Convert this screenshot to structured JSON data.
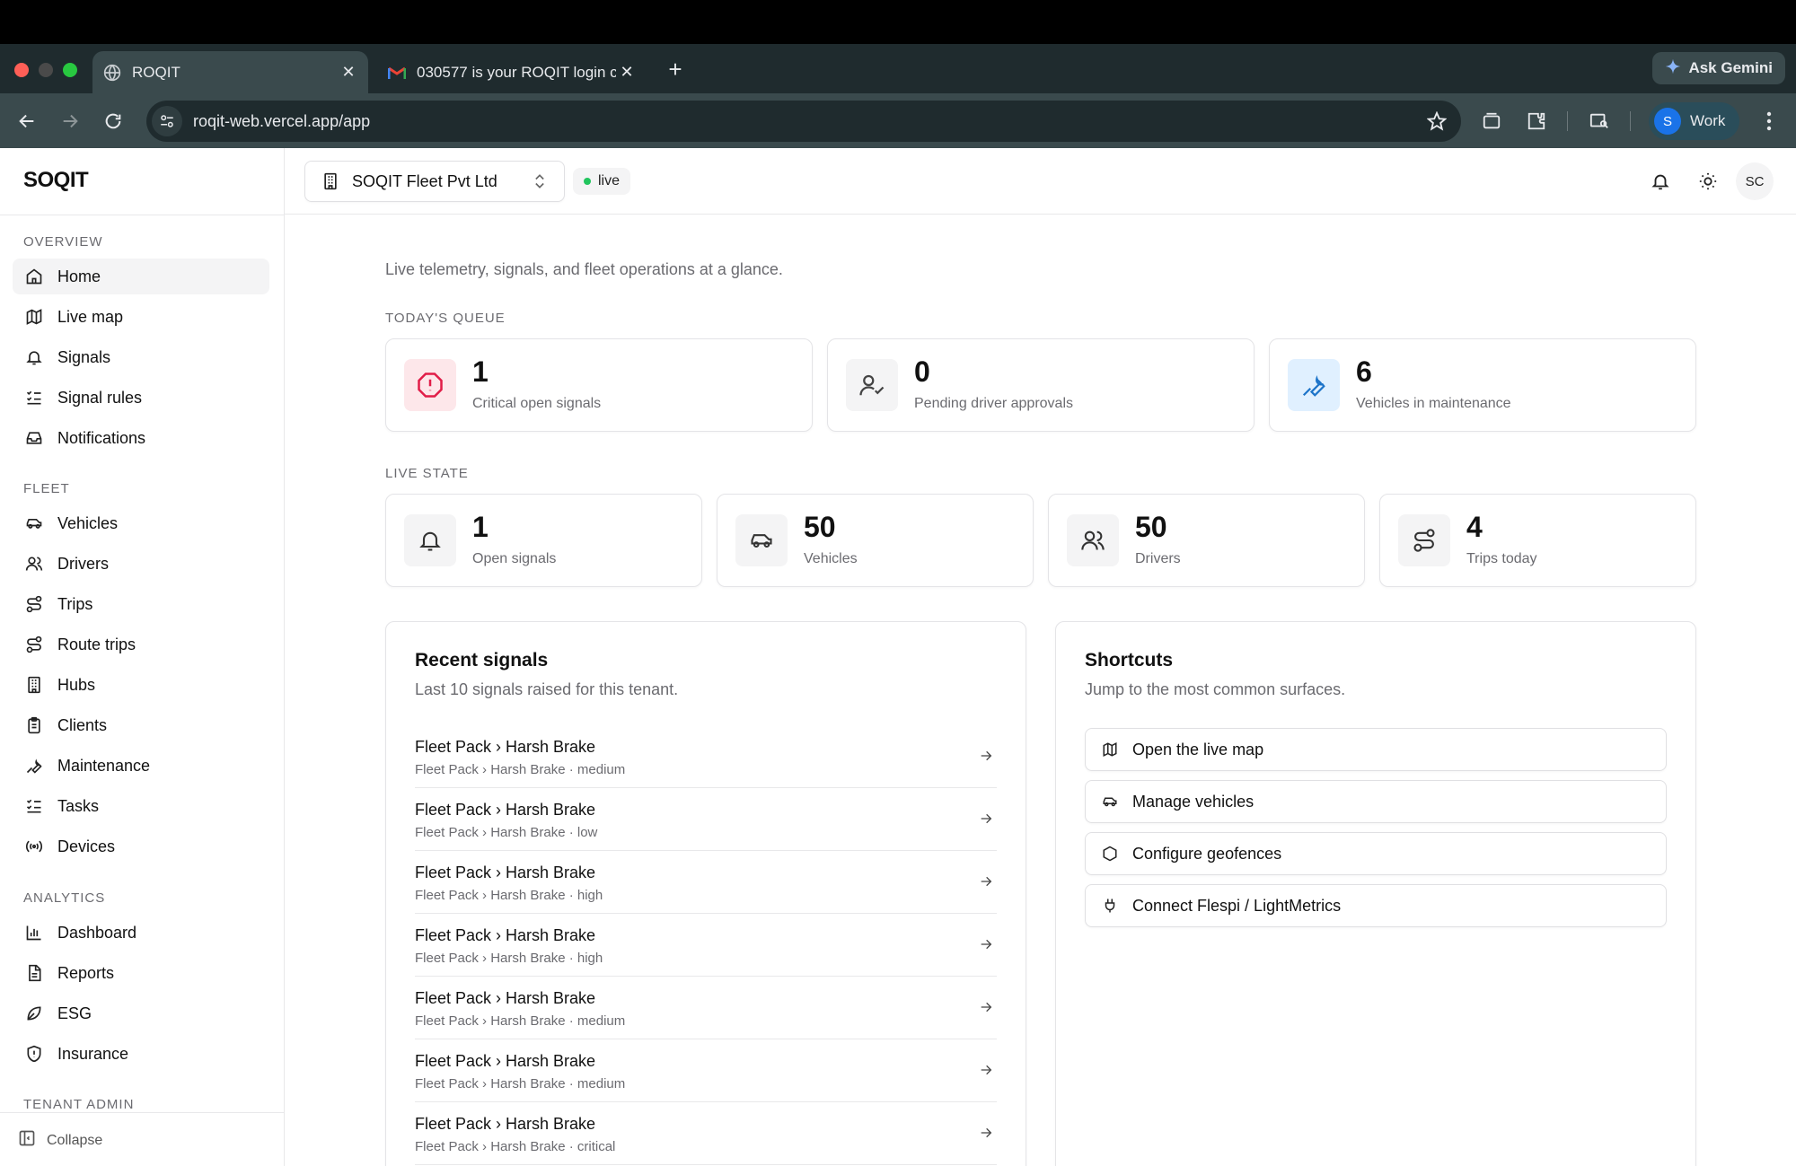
{
  "browser": {
    "tabs": [
      {
        "title": "ROQIT",
        "active": true
      },
      {
        "title": "030577 is your ROQIT login c",
        "active": false
      }
    ],
    "url": "roqit-web.vercel.app/app",
    "gemini_label": "Ask Gemini",
    "profile": {
      "initial": "S",
      "label": "Work"
    }
  },
  "app": {
    "brand": "SOQIT",
    "tenant": "SOQIT Fleet Pvt Ltd",
    "status_badge": "live",
    "user_initials": "SC",
    "colors": {
      "accent_green": "#22c55e",
      "critical_bg": "#fde7ea",
      "critical_fg": "#e11d48",
      "info_bg": "#e0f0ff",
      "info_fg": "#1d74c9"
    }
  },
  "sidebar": {
    "sections": [
      {
        "label": "OVERVIEW",
        "items": [
          {
            "label": "Home",
            "icon": "home-icon",
            "active": true
          },
          {
            "label": "Live map",
            "icon": "map-icon"
          },
          {
            "label": "Signals",
            "icon": "bell-icon"
          },
          {
            "label": "Signal rules",
            "icon": "list-checks-icon"
          },
          {
            "label": "Notifications",
            "icon": "inbox-icon"
          }
        ]
      },
      {
        "label": "FLEET",
        "items": [
          {
            "label": "Vehicles",
            "icon": "car-icon"
          },
          {
            "label": "Drivers",
            "icon": "users-icon"
          },
          {
            "label": "Trips",
            "icon": "route-icon"
          },
          {
            "label": "Route trips",
            "icon": "route-icon"
          },
          {
            "label": "Hubs",
            "icon": "building-icon"
          },
          {
            "label": "Clients",
            "icon": "clipboard-icon"
          },
          {
            "label": "Maintenance",
            "icon": "wrench-icon"
          },
          {
            "label": "Tasks",
            "icon": "list-checks-icon"
          },
          {
            "label": "Devices",
            "icon": "radio-icon"
          }
        ]
      },
      {
        "label": "ANALYTICS",
        "items": [
          {
            "label": "Dashboard",
            "icon": "bar-chart-icon"
          },
          {
            "label": "Reports",
            "icon": "file-text-icon"
          },
          {
            "label": "ESG",
            "icon": "leaf-icon"
          },
          {
            "label": "Insurance",
            "icon": "shield-alert-icon"
          }
        ]
      },
      {
        "label": "TENANT ADMIN",
        "items": []
      }
    ],
    "collapse_label": "Collapse"
  },
  "main": {
    "intro": "Live telemetry, signals, and fleet operations at a glance.",
    "queue_label": "TODAY'S QUEUE",
    "queue": [
      {
        "value": "1",
        "label": "Critical open signals",
        "icon": "alert-octagon-icon"
      },
      {
        "value": "0",
        "label": "Pending driver approvals",
        "icon": "user-check-icon"
      },
      {
        "value": "6",
        "label": "Vehicles in maintenance",
        "icon": "wrench-icon"
      }
    ],
    "live_label": "LIVE STATE",
    "live": [
      {
        "value": "1",
        "label": "Open signals",
        "icon": "bell-icon"
      },
      {
        "value": "50",
        "label": "Vehicles",
        "icon": "car-icon"
      },
      {
        "value": "50",
        "label": "Drivers",
        "icon": "users-icon"
      },
      {
        "value": "4",
        "label": "Trips today",
        "icon": "route-icon"
      }
    ],
    "recent": {
      "title": "Recent signals",
      "subtitle": "Last 10 signals raised for this tenant.",
      "rows": [
        {
          "title": "Fleet Pack › Harsh Brake",
          "meta": "Fleet Pack › Harsh Brake · medium"
        },
        {
          "title": "Fleet Pack › Harsh Brake",
          "meta": "Fleet Pack › Harsh Brake · low"
        },
        {
          "title": "Fleet Pack › Harsh Brake",
          "meta": "Fleet Pack › Harsh Brake · high"
        },
        {
          "title": "Fleet Pack › Harsh Brake",
          "meta": "Fleet Pack › Harsh Brake · high"
        },
        {
          "title": "Fleet Pack › Harsh Brake",
          "meta": "Fleet Pack › Harsh Brake · medium"
        },
        {
          "title": "Fleet Pack › Harsh Brake",
          "meta": "Fleet Pack › Harsh Brake · medium"
        },
        {
          "title": "Fleet Pack › Harsh Brake",
          "meta": "Fleet Pack › Harsh Brake · critical"
        }
      ]
    },
    "shortcuts": {
      "title": "Shortcuts",
      "subtitle": "Jump to the most common surfaces.",
      "items": [
        {
          "label": "Open the live map",
          "icon": "map-icon"
        },
        {
          "label": "Manage vehicles",
          "icon": "car-icon"
        },
        {
          "label": "Configure geofences",
          "icon": "hexagon-icon"
        },
        {
          "label": "Connect Flespi / LightMetrics",
          "icon": "plug-icon"
        }
      ]
    }
  }
}
